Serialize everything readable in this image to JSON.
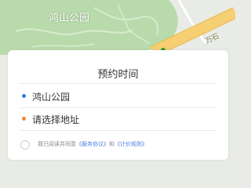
{
  "map": {
    "park_label": "鸿山公园",
    "road_label": "万石",
    "colors": {
      "park": "#b9dbac",
      "road": "#f6cf72",
      "ground": "#e9ece6"
    }
  },
  "booking_card": {
    "title": "预约时间",
    "origin_label": "鸿山公园",
    "destination_label": "请选择地址",
    "origin_dot_color": "#2f7de1",
    "destination_dot_color": "#f0873a"
  },
  "agreement": {
    "prefix": "我已阅读并同意",
    "service_link": "《服务协议》",
    "joiner": "和",
    "pricing_link": "《计价规则》"
  }
}
